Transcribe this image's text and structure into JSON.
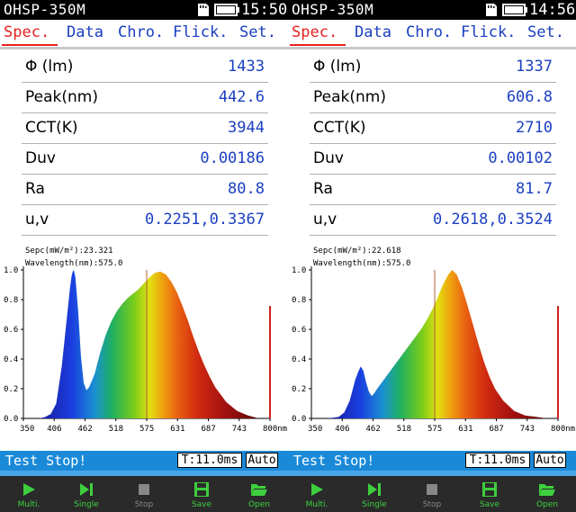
{
  "screens": [
    {
      "device": "OHSP-350M",
      "time": "15:50",
      "tabs": [
        "Spec.",
        "Data",
        "Chro.",
        "Flick.",
        "Set."
      ],
      "active_tab": "Spec.",
      "measurements": [
        {
          "label": "Φ (lm)",
          "value": "1433"
        },
        {
          "label": "Peak(nm)",
          "value": "442.6"
        },
        {
          "label": "CCT(K)",
          "value": "3944"
        },
        {
          "label": "Duv",
          "value": "0.00186"
        },
        {
          "label": "Ra",
          "value": "80.8"
        },
        {
          "label": "u,v",
          "value": "0.2251,0.3367"
        }
      ],
      "sepc_text": "Sepc(mW/m²):23.321",
      "wavelength_text": "Wavelength(nm):575.0",
      "status_msg": "Test Stop!",
      "integration": "T:11.0ms",
      "mode": "Auto"
    },
    {
      "device": "OHSP-350M",
      "time": "14:56",
      "tabs": [
        "Spec.",
        "Data",
        "Chro.",
        "Flick.",
        "Set."
      ],
      "active_tab": "Spec.",
      "measurements": [
        {
          "label": "Φ (lm)",
          "value": "1337"
        },
        {
          "label": "Peak(nm)",
          "value": "606.8"
        },
        {
          "label": "CCT(K)",
          "value": "2710"
        },
        {
          "label": "Duv",
          "value": "0.00102"
        },
        {
          "label": "Ra",
          "value": "81.7"
        },
        {
          "label": "u,v",
          "value": "0.2618,0.3524"
        }
      ],
      "sepc_text": "Sepc(mW/m²):22.618",
      "wavelength_text": "Wavelength(nm):575.0",
      "status_msg": "Test Stop!",
      "integration": "T:11.0ms",
      "mode": "Auto"
    }
  ],
  "toolbar": [
    {
      "label": "Multi.",
      "icon": "play-icon",
      "active": true
    },
    {
      "label": "Single",
      "icon": "step-forward-icon",
      "active": true
    },
    {
      "label": "Stop",
      "icon": "stop-icon",
      "active": false
    },
    {
      "label": "Save",
      "icon": "save-icon",
      "active": true
    },
    {
      "label": "Open",
      "icon": "folder-open-icon",
      "active": true
    }
  ],
  "chart_data": [
    {
      "type": "area",
      "x_ticks": [
        "350",
        "406",
        "462",
        "518",
        "575",
        "631",
        "687",
        "743",
        "800nm"
      ],
      "y_ticks": [
        "0.0",
        "0.2",
        "0.4",
        "0.6",
        "0.8",
        "1.0"
      ],
      "xlim": [
        350,
        800
      ],
      "ylim": [
        0,
        1.0
      ],
      "marker_nm": 575,
      "x": [
        380,
        390,
        400,
        410,
        420,
        430,
        435,
        438,
        440,
        442,
        445,
        450,
        455,
        460,
        465,
        470,
        480,
        490,
        500,
        510,
        520,
        530,
        540,
        550,
        560,
        570,
        580,
        590,
        600,
        610,
        620,
        630,
        640,
        650,
        660,
        670,
        680,
        690,
        700,
        720,
        740,
        760,
        780
      ],
      "y": [
        0.0,
        0.01,
        0.03,
        0.1,
        0.35,
        0.7,
        0.88,
        0.96,
        0.99,
        1.0,
        0.95,
        0.72,
        0.42,
        0.24,
        0.19,
        0.21,
        0.3,
        0.44,
        0.56,
        0.65,
        0.72,
        0.77,
        0.81,
        0.84,
        0.87,
        0.91,
        0.95,
        0.98,
        0.99,
        0.97,
        0.92,
        0.85,
        0.76,
        0.66,
        0.55,
        0.45,
        0.36,
        0.28,
        0.21,
        0.11,
        0.05,
        0.02,
        0.0
      ]
    },
    {
      "type": "area",
      "x_ticks": [
        "350",
        "406",
        "462",
        "518",
        "575",
        "631",
        "687",
        "743",
        "800nm"
      ],
      "y_ticks": [
        "0.0",
        "0.2",
        "0.4",
        "0.6",
        "0.8",
        "1.0"
      ],
      "xlim": [
        350,
        800
      ],
      "ylim": [
        0,
        1.0
      ],
      "marker_nm": 575,
      "x": [
        380,
        400,
        410,
        420,
        430,
        435,
        440,
        445,
        450,
        455,
        460,
        465,
        470,
        480,
        490,
        500,
        510,
        520,
        530,
        540,
        550,
        560,
        570,
        580,
        590,
        600,
        607,
        615,
        625,
        635,
        645,
        655,
        665,
        675,
        685,
        700,
        720,
        740,
        760,
        780
      ],
      "y": [
        0.0,
        0.01,
        0.04,
        0.12,
        0.26,
        0.31,
        0.35,
        0.32,
        0.24,
        0.18,
        0.15,
        0.17,
        0.2,
        0.25,
        0.3,
        0.35,
        0.4,
        0.45,
        0.5,
        0.55,
        0.6,
        0.66,
        0.73,
        0.81,
        0.9,
        0.97,
        1.0,
        0.97,
        0.88,
        0.76,
        0.63,
        0.5,
        0.38,
        0.28,
        0.2,
        0.12,
        0.05,
        0.02,
        0.01,
        0.0
      ]
    }
  ]
}
